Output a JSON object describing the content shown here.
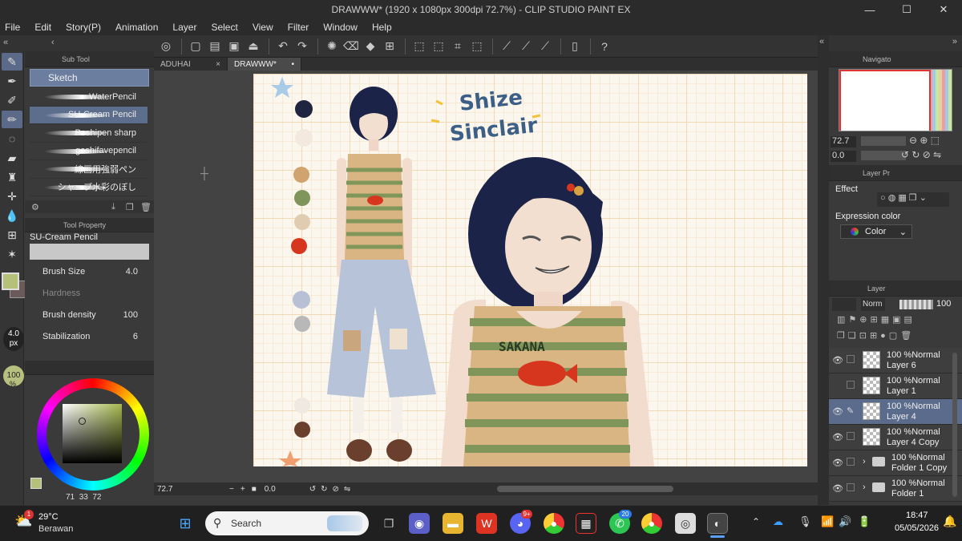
{
  "window": {
    "title": "DRAWWW* (1920 x 1080px 300dpi 72.7%) - CLIP STUDIO PAINT EX",
    "min": "—",
    "max": "☐",
    "close": "✕"
  },
  "menu": [
    "File",
    "Edit",
    "Story(P)",
    "Animation",
    "Layer",
    "Select",
    "View",
    "Filter",
    "Window",
    "Help"
  ],
  "doc_tabs": [
    {
      "label": "ADUHAI",
      "marker": "×"
    },
    {
      "label": "DRAWWW*",
      "marker": "•"
    }
  ],
  "subtool": {
    "header": "Sub Tool",
    "group": "Sketch",
    "brushes": [
      "WaterPencil",
      "SU-Cream Pencil",
      "Poshipen sharp",
      "goshifavepencil",
      "線画用強弱ペン",
      "シャープ水彩のぼし"
    ],
    "selected_index": 1
  },
  "tool_property": {
    "header": "Tool Property",
    "brush_name": "SU-Cream Pencil",
    "rows": [
      {
        "label": "Brush Size",
        "value": "4.0"
      },
      {
        "label": "Hardness",
        "value": ""
      },
      {
        "label": "Brush density",
        "value": "100"
      },
      {
        "label": "Stabilization",
        "value": "6"
      }
    ]
  },
  "left_indicators": {
    "brush_size_value": "4.0",
    "brush_size_unit": "px",
    "opacity": "100",
    "opacity_unit": "%"
  },
  "color_values": {
    "h": "71",
    "s": "33",
    "v": "72"
  },
  "status": {
    "zoom": "72.7",
    "angle": "0.0"
  },
  "navigator": {
    "header": "Navigato",
    "zoom": "72.7",
    "angle": "0.0"
  },
  "layer_property": {
    "header": "Layer Pr",
    "effect_label": "Effect",
    "expression_color_label": "Expression color",
    "expression_color_value": "Color"
  },
  "layer_panel": {
    "header": "Layer",
    "blend_mode": "Norm",
    "opacity": "100",
    "layers": [
      {
        "mode": "100 %Normal",
        "name": "Layer 6",
        "type": "layer"
      },
      {
        "mode": "100 %Normal",
        "name": "Layer 1",
        "type": "layer"
      },
      {
        "mode": "100 %Normal",
        "name": "Layer 4",
        "type": "layer",
        "selected": true
      },
      {
        "mode": "100 %Normal",
        "name": "Layer 4 Copy",
        "type": "layer"
      },
      {
        "mode": "100 %Normal",
        "name": "Folder 1 Copy",
        "type": "folder"
      },
      {
        "mode": "100 %Normal",
        "name": "Folder 1",
        "type": "folder"
      }
    ]
  },
  "canvas_art": {
    "lettering": "Shize Sinclair",
    "palette": [
      "#1f2540",
      "#f3e9df",
      "#d1a46f",
      "#7f955a",
      "#e0cdb1",
      "#d7361e",
      "#b7c0d4",
      "#b8b8b8",
      "#efe9e2",
      "#6a3f2e"
    ],
    "shirt_text": "SAKANA"
  },
  "taskbar": {
    "weather_temp": "29°C",
    "weather_desc": "Berawan",
    "weather_badge": "1",
    "search_placeholder": "Search",
    "time": "18:47",
    "date": "05/05/2026",
    "badge_discord": "9+",
    "badge_whatsapp": "20"
  }
}
